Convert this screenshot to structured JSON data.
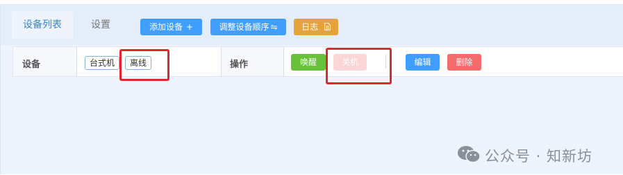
{
  "tabs": {
    "device_list": "设备列表",
    "settings": "设置"
  },
  "toolbar": {
    "add_device": "添加设备",
    "reorder_devices": "调整设备顺序",
    "log": "日志"
  },
  "table": {
    "device_header": "设备",
    "actions_header": "操作",
    "tags": [
      "台式机",
      "离线"
    ],
    "actions": {
      "wake": "唤醒",
      "shutdown": "关机",
      "edit": "编辑",
      "delete": "删除"
    }
  },
  "watermark": {
    "text": "公众号 · 知新坊"
  },
  "icons": {
    "add": "plus-icon",
    "reorder": "swap-icon",
    "log": "document-icon",
    "watermark": "wechat-icon"
  },
  "colors": {
    "primary": "#409eff",
    "warning": "#e6a23c",
    "success": "#67c23a",
    "danger": "#f56c6c",
    "danger_disabled": "#fbd6d6",
    "highlight": "#e3262b"
  }
}
